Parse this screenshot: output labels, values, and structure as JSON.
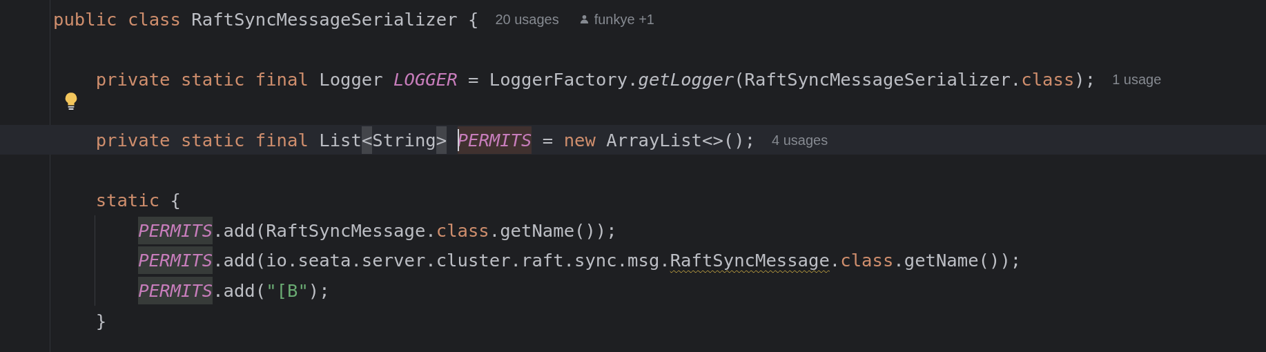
{
  "editor": {
    "lines": [
      {
        "current": false,
        "tokens": [
          {
            "text": "public ",
            "kind": "keyword"
          },
          {
            "text": "class ",
            "kind": "keyword"
          },
          {
            "text": "RaftSyncMessageSerializer {",
            "kind": "plain"
          }
        ],
        "hints": [
          {
            "kind": "usages",
            "text": "20 usages"
          },
          {
            "kind": "author",
            "text": "funkye +1"
          }
        ]
      },
      {
        "current": false
      },
      {
        "current": false,
        "indented": true,
        "tokens": [
          {
            "text": "private ",
            "kind": "keyword"
          },
          {
            "text": "static ",
            "kind": "keyword"
          },
          {
            "text": "final ",
            "kind": "keyword"
          },
          {
            "text": "Logger ",
            "kind": "plain"
          },
          {
            "text": "LOGGER",
            "kind": "constant"
          },
          {
            "text": " = LoggerFactory.",
            "kind": "plain"
          },
          {
            "text": "getLogger",
            "kind": "static-call"
          },
          {
            "text": "(RaftSyncMessageSerializer.",
            "kind": "plain"
          },
          {
            "text": "class",
            "kind": "keyword"
          },
          {
            "text": ");",
            "kind": "plain"
          }
        ],
        "hints": [
          {
            "kind": "usages",
            "text": "1 usage"
          }
        ]
      },
      {
        "current": false,
        "bulb": true
      },
      {
        "current": true,
        "indented": true,
        "tokens": [
          {
            "text": "private ",
            "kind": "keyword"
          },
          {
            "text": "static ",
            "kind": "keyword"
          },
          {
            "text": "final ",
            "kind": "keyword"
          },
          {
            "text": "List",
            "kind": "plain"
          },
          {
            "text": "<",
            "kind": "plain",
            "bracket_match": true
          },
          {
            "text": "String",
            "kind": "plain"
          },
          {
            "text": ">",
            "kind": "plain",
            "bracket_match": true,
            "space_after": true
          },
          {
            "text": "PERMITS",
            "kind": "constant",
            "write_usage": true,
            "caret": true
          },
          {
            "text": " = ",
            "kind": "plain"
          },
          {
            "text": "new ",
            "kind": "keyword"
          },
          {
            "text": "ArrayList<>();",
            "kind": "plain"
          }
        ],
        "hints": [
          {
            "kind": "usages",
            "text": "4 usages"
          }
        ]
      },
      {
        "current": false
      },
      {
        "current": false,
        "indented": true,
        "tokens": [
          {
            "text": "static ",
            "kind": "keyword"
          },
          {
            "text": "{",
            "kind": "plain"
          }
        ]
      },
      {
        "current": false,
        "indented": true,
        "guide": true,
        "tokens": [
          {
            "text": "PERMITS",
            "kind": "constant",
            "read_usage": true
          },
          {
            "text": ".add(RaftSyncMessage.",
            "kind": "plain"
          },
          {
            "text": "class",
            "kind": "keyword"
          },
          {
            "text": ".getName());",
            "kind": "plain"
          }
        ]
      },
      {
        "current": false,
        "indented": true,
        "guide": true,
        "tokens": [
          {
            "text": "PERMITS",
            "kind": "constant",
            "read_usage": true
          },
          {
            "text": ".add(io.seata.server.cluster.raft.sync.msg.",
            "kind": "plain"
          },
          {
            "text": "RaftSyncMessage",
            "kind": "plain",
            "warning": true
          },
          {
            "text": ".",
            "kind": "plain"
          },
          {
            "text": "class",
            "kind": "keyword"
          },
          {
            "text": ".getName());",
            "kind": "plain"
          }
        ]
      },
      {
        "current": false,
        "indented": true,
        "guide": true,
        "tokens": [
          {
            "text": "PERMITS",
            "kind": "constant",
            "read_usage": true
          },
          {
            "text": ".add(",
            "kind": "plain"
          },
          {
            "text": "\"[B\"",
            "kind": "string"
          },
          {
            "text": ");",
            "kind": "plain"
          }
        ]
      },
      {
        "current": false,
        "indented": true,
        "tokens": [
          {
            "text": "}",
            "kind": "plain"
          }
        ]
      }
    ]
  }
}
